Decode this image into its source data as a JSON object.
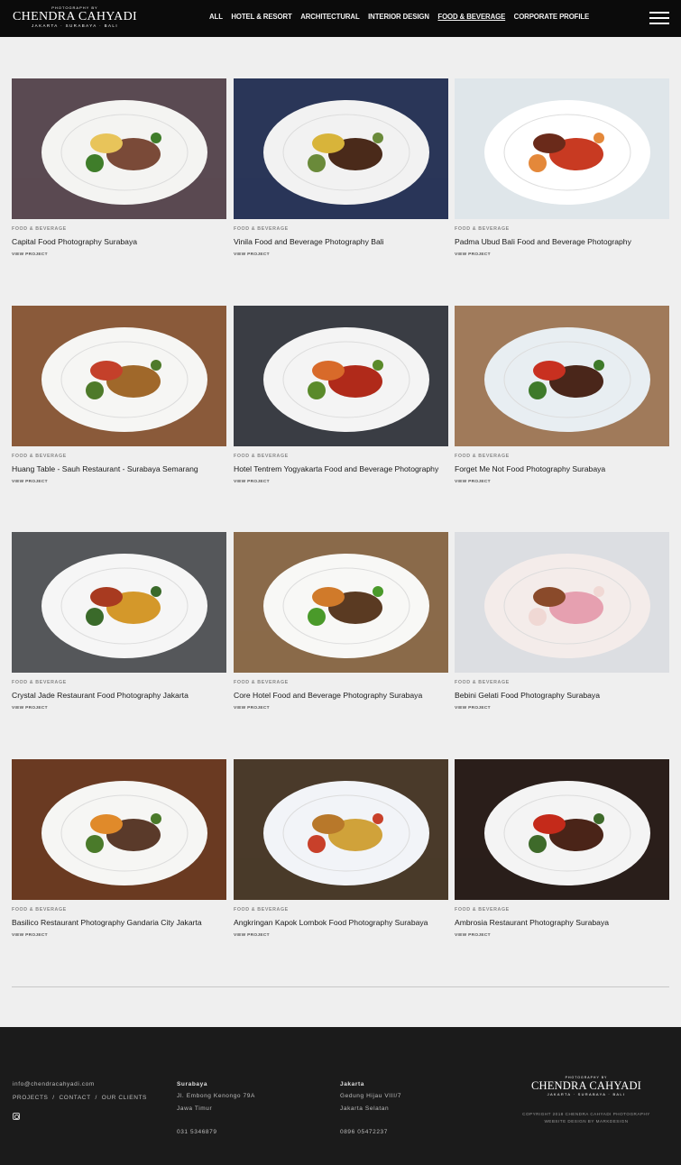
{
  "header": {
    "logo_pre": "PHOTOGRAPHY BY",
    "logo_name": "CHENDRA CAHYADI",
    "logo_sub": "JAKARTA  ·  SURABAYA  ·  BALI",
    "nav": [
      "ALL",
      "HOTEL & RESORT",
      "ARCHITECTURAL",
      "INTERIOR DESIGN",
      "FOOD & BEVERAGE",
      "CORPORATE PROFILE"
    ],
    "active_nav": "FOOD & BEVERAGE",
    "menu_icon": "hamburger-icon"
  },
  "projects": [
    {
      "category": "FOOD & BEVERAGE",
      "title": "Capital Food Photography Surabaya",
      "link": "VIEW PROJECT"
    },
    {
      "category": "FOOD & BEVERAGE",
      "title": "Vinila Food and Beverage Photography Bali",
      "link": "VIEW PROJECT"
    },
    {
      "category": "FOOD & BEVERAGE",
      "title": "Padma Ubud Bali Food and Beverage Photography",
      "link": "VIEW PROJECT"
    },
    {
      "category": "FOOD & BEVERAGE",
      "title": "Huang Table - Sauh Restaurant - Surabaya Semarang",
      "link": "VIEW PROJECT"
    },
    {
      "category": "FOOD & BEVERAGE",
      "title": "Hotel Tentrem Yogyakarta Food and Beverage Photography",
      "link": "VIEW PROJECT"
    },
    {
      "category": "FOOD & BEVERAGE",
      "title": "Forget Me Not Food Photography Surabaya",
      "link": "VIEW PROJECT"
    },
    {
      "category": "FOOD & BEVERAGE",
      "title": "Crystal Jade Restaurant Food Photography Jakarta",
      "link": "VIEW PROJECT"
    },
    {
      "category": "FOOD & BEVERAGE",
      "title": "Core Hotel Food and Beverage Photography Surabaya",
      "link": "VIEW PROJECT"
    },
    {
      "category": "FOOD & BEVERAGE",
      "title": "Bebini Gelati Food Photography Surabaya",
      "link": "VIEW PROJECT"
    },
    {
      "category": "FOOD & BEVERAGE",
      "title": "Basilico Restaurant Photography Gandaria City Jakarta",
      "link": "VIEW PROJECT"
    },
    {
      "category": "FOOD & BEVERAGE",
      "title": "Angkringan Kapok Lombok Food Photography Surabaya",
      "link": "VIEW PROJECT"
    },
    {
      "category": "FOOD & BEVERAGE",
      "title": "Ambrosia Restaurant Photography Surabaya",
      "link": "VIEW PROJECT"
    }
  ],
  "footer": {
    "email": "info@chendracahyadi.com",
    "links": [
      "PROJECTS",
      "CONTACT",
      "OUR CLIENTS"
    ],
    "social_icon": "instagram-icon",
    "surabaya": {
      "city": "Surabaya",
      "line1": "Jl. Embong Kenongo 79A",
      "line2": "Jawa Timur",
      "phone": "031 5346879"
    },
    "jakarta": {
      "city": "Jakarta",
      "line1": "Gedung Hijau VIII/7",
      "line2": "Jakarta Selatan",
      "phone": "0896 05472237"
    },
    "logo_pre": "PHOTOGRAPHY BY",
    "logo_name": "CHENDRA CAHYADI",
    "logo_sub": "JAKARTA  ·  SURABAYA  ·  BALI",
    "copyright": "COPYRIGHT 2018 CHENDRA CAHYADI PHOTOGRAPHY",
    "credit": "WEBSITE DESIGN BY MARKDESIGN"
  },
  "colors": {
    "header_bg": "#0b0b0b",
    "page_bg": "#efefef",
    "footer_bg": "#1b1b1b"
  }
}
